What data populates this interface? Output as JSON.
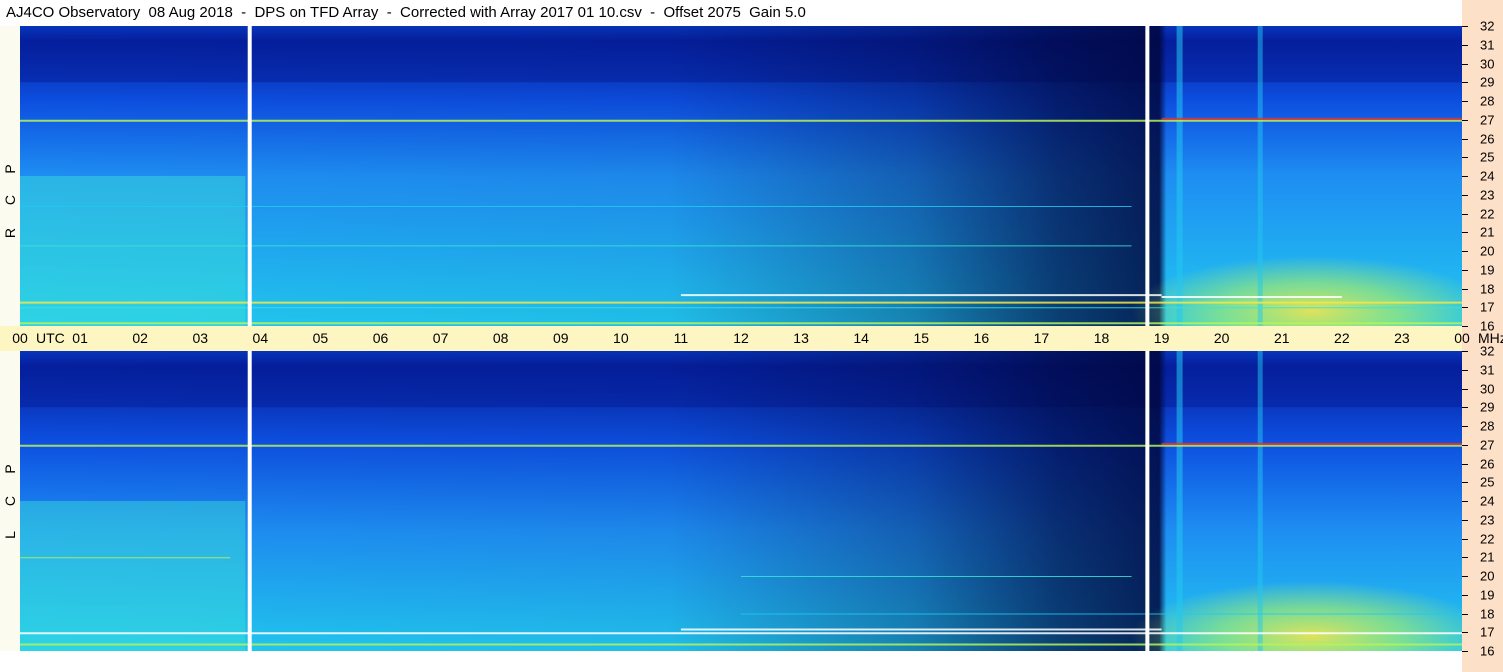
{
  "header": {
    "title": "AJ4CO Observatory  08 Aug 2018  -  DPS on TFD Array  -  Corrected with Array 2017 01 10.csv  -  Offset 2075  Gain 5.0"
  },
  "time_axis": {
    "labels": [
      "00",
      "01",
      "02",
      "03",
      "04",
      "05",
      "06",
      "07",
      "08",
      "09",
      "10",
      "11",
      "12",
      "13",
      "14",
      "15",
      "16",
      "17",
      "18",
      "19",
      "20",
      "21",
      "22",
      "23",
      "00"
    ],
    "utc_label": "UTC",
    "unit_label": "MHz"
  },
  "panels": [
    {
      "id": "rcp",
      "letters": [
        "R",
        "C",
        "P"
      ]
    },
    {
      "id": "lcp",
      "letters": [
        "L",
        "C",
        "P"
      ]
    }
  ],
  "colors": {
    "deep": "#00063d",
    "dark_blue": "#051f9c",
    "blue": "#0d4fe0",
    "mid_blue": "#1e8ef2",
    "cyan": "#22c8f0",
    "aqua": "#3be3d8",
    "yellow_green": "#b6f25a",
    "yellow": "#f5e64a",
    "red": "#e8322a",
    "white": "#ffffff",
    "mhz_strip": "#fde0c8",
    "time_band": "#fdf6c3"
  },
  "chart_data": {
    "type": "heatmap",
    "title": "AJ4CO Observatory  08 Aug 2018  -  DPS on TFD Array  -  Corrected with Array 2017 01 10.csv  -  Offset 2075  Gain 5.0",
    "xlabel": "UTC",
    "ylabel": "MHz",
    "x_ticks": [
      "00",
      "01",
      "02",
      "03",
      "04",
      "05",
      "06",
      "07",
      "08",
      "09",
      "10",
      "11",
      "12",
      "13",
      "14",
      "15",
      "16",
      "17",
      "18",
      "19",
      "20",
      "21",
      "22",
      "23",
      "00"
    ],
    "y_ticks": [
      32,
      31,
      30,
      29,
      28,
      27,
      26,
      25,
      24,
      23,
      22,
      21,
      20,
      19,
      18,
      17,
      16
    ],
    "ylim": [
      16,
      32
    ],
    "series": [
      {
        "name": "RCP"
      },
      {
        "name": "LCP"
      }
    ]
  }
}
